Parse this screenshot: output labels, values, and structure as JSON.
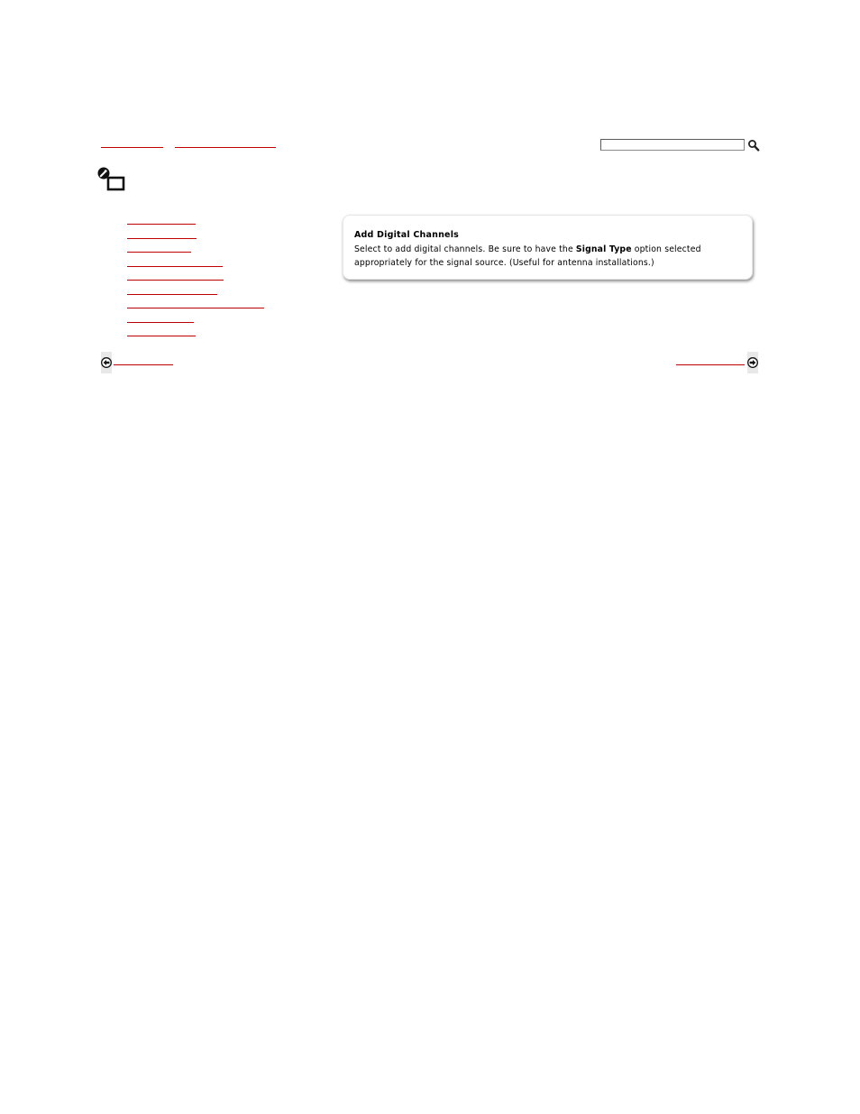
{
  "header": {
    "search": {
      "value": "",
      "placeholder": ""
    },
    "icons": {
      "search": "magnifier-icon",
      "page": "settings-wrench-screen-icon"
    }
  },
  "help": {
    "title": "Add Digital Channels",
    "text_1": "Select to add digital channels. Be sure to have the ",
    "text_bold": "Signal Type",
    "text_2": " option selected appropriately for the signal source. (Useful for antenna installations.)"
  },
  "footer": {
    "icons": {
      "previous": "arrow-left-icon",
      "next": "arrow-right-icon"
    }
  },
  "colors": {
    "link": "#c00000",
    "box_border": "#e6e6e6"
  }
}
